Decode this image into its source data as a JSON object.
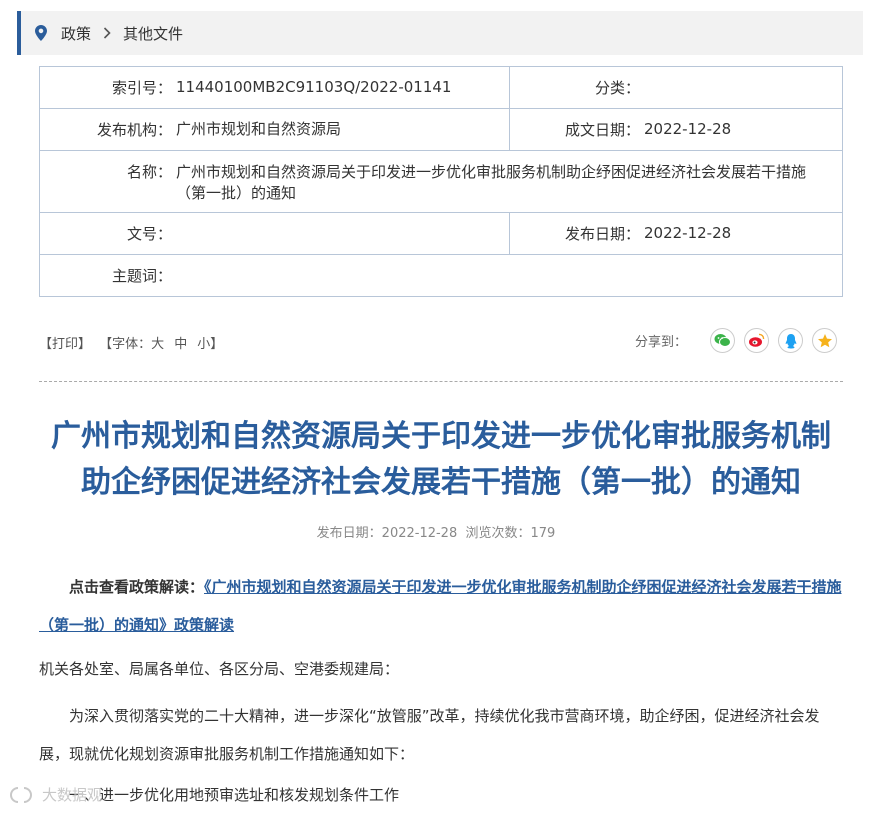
{
  "breadcrumb": {
    "items": [
      "政策",
      "其他文件"
    ]
  },
  "meta": {
    "index_label": "索引号：",
    "index_value": "11440100MB2C91103Q/2022-01141",
    "category_label": "分类：",
    "category_value": "",
    "publisher_label": "发布机构：",
    "publisher_value": "广州市规划和自然资源局",
    "created_label": "成文日期：",
    "created_value": "2022-12-28",
    "name_label": "名称：",
    "name_value": "广州市规划和自然资源局关于印发进一步优化审批服务机制助企纾困促进经济社会发展若干措施（第一批）的通知",
    "doc_no_label": "文号：",
    "doc_no_value": "",
    "publish_date_label": "发布日期：",
    "publish_date_value": "2022-12-28",
    "subject_label": "主题词：",
    "subject_value": ""
  },
  "tools": {
    "print": "【打印】",
    "font_prefix": "【字体：",
    "font_large": "大",
    "font_medium": "中",
    "font_small": "小",
    "font_suffix": "】"
  },
  "share": {
    "label": "分享到："
  },
  "article": {
    "title": "广州市规划和自然资源局关于印发进一步优化审批服务机制助企纾困促进经济社会发展若干措施（第一批）的通知",
    "info": "发布日期：2022-12-28  浏览次数：179",
    "interpret_prefix": "点击查看政策解读：",
    "interpret_link": "《广州市规划和自然资源局关于印发进一步优化审批服务机制助企纾困促进经济社会发展若干措施（第一批）的通知》政策解读",
    "salutation": "机关各处室、局属各单位、各区分局、空港委规建局：",
    "para1": "为深入贯彻落实党的二十大精神，进一步深化“放管服”改革，持续优化我市营商环境，助企纾困，促进经济社会发展，现就优化规划资源审批服务机制工作措施通知如下：",
    "para2": "一、进一步优化用地预审选址和核发规划条件工作"
  },
  "watermark": {
    "text": "大数据观"
  },
  "colors": {
    "accent": "#2a5d9c",
    "table_border": "#b8c6d8",
    "breadcrumb_bg": "#f2f2f2"
  }
}
